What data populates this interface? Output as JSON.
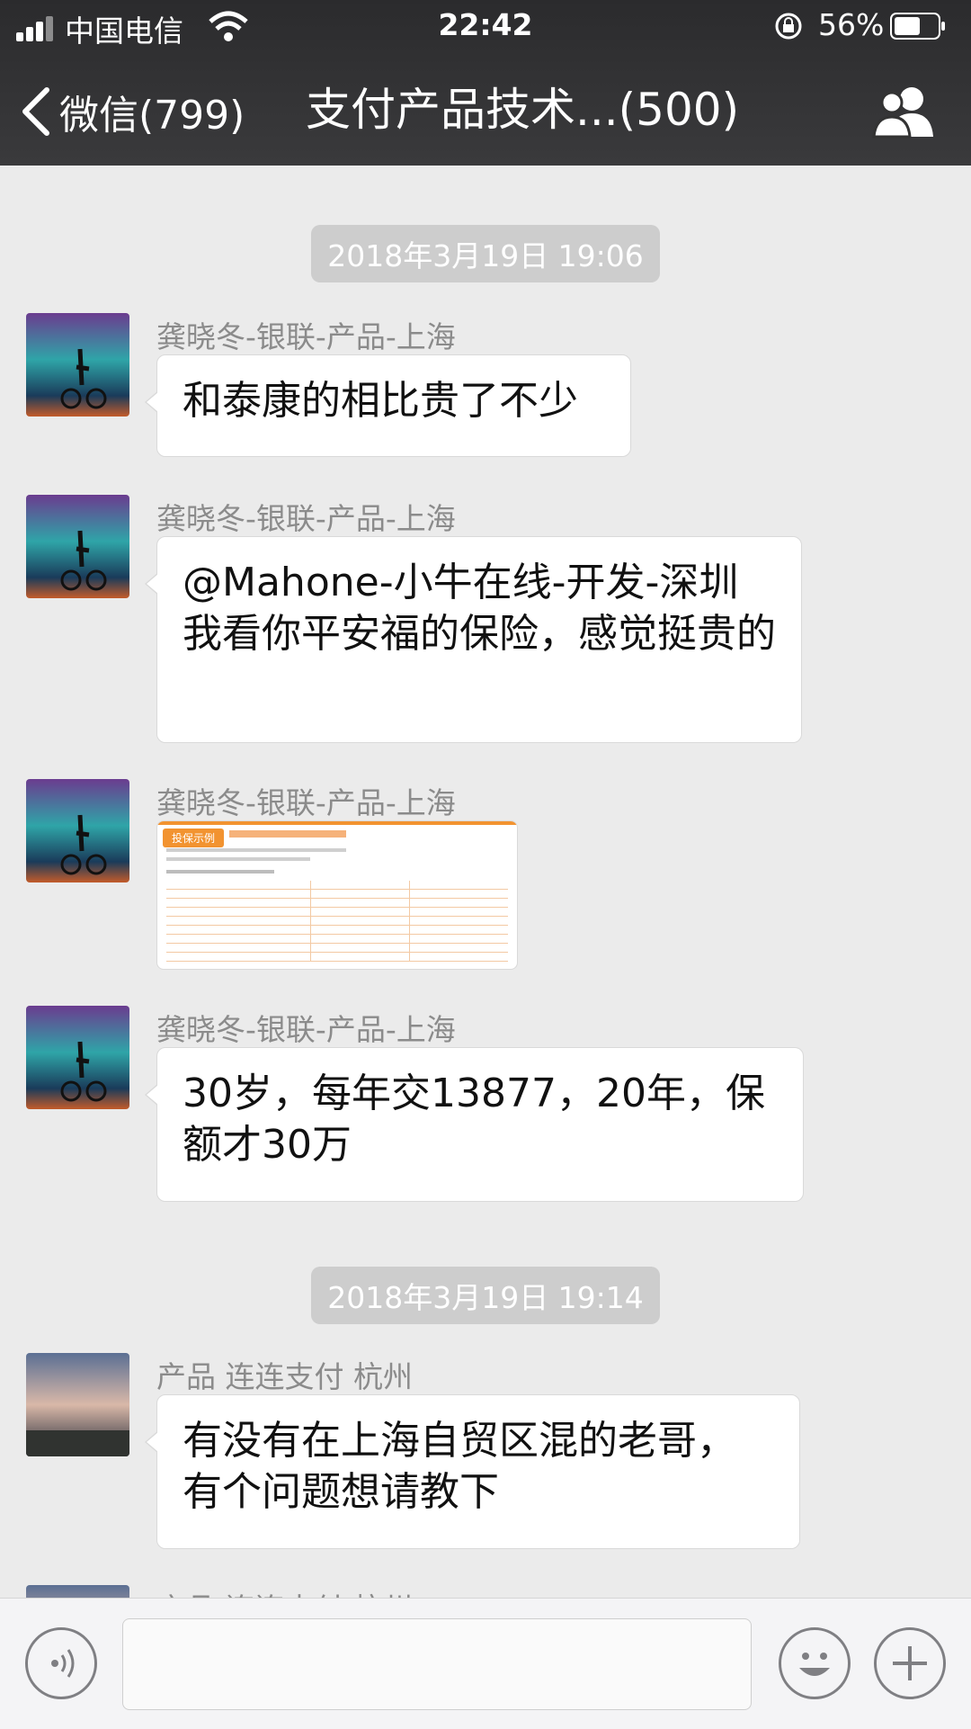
{
  "status_bar": {
    "carrier": "中国电信",
    "time": "22:42",
    "battery": "56%"
  },
  "nav": {
    "back_label": "微信(799)",
    "title": "支付产品技术...(500)"
  },
  "messages": {
    "ts1": "2018年3月19日 19:06",
    "m1": {
      "sender": "龚晓冬-银联-产品-上海",
      "text": "和泰康的相比贵了不少"
    },
    "m2": {
      "sender": "龚晓冬-银联-产品-上海",
      "text": "@Mahone-小牛在线-开发-深圳 我看你平安福的保险，感觉挺贵的"
    },
    "m3": {
      "sender": "龚晓冬-银联-产品-上海",
      "image_label": "投保示例"
    },
    "m4": {
      "sender": "龚晓冬-银联-产品-上海",
      "text": "30岁，每年交13877，20年，保额才30万"
    },
    "ts2": "2018年3月19日 19:14",
    "m5": {
      "sender": "产品 连连支付 杭州",
      "text": "有没有在上海自贸区混的老哥，有个问题想请教下"
    },
    "m6": {
      "sender": "产品 连连支付 杭州"
    }
  },
  "input": {
    "value": ""
  },
  "icons": [
    "signal-icon",
    "wifi-icon",
    "lock-rotation-icon",
    "battery-icon",
    "back-chevron-icon",
    "group-members-icon",
    "voice-icon",
    "emoji-icon",
    "plus-icon"
  ]
}
